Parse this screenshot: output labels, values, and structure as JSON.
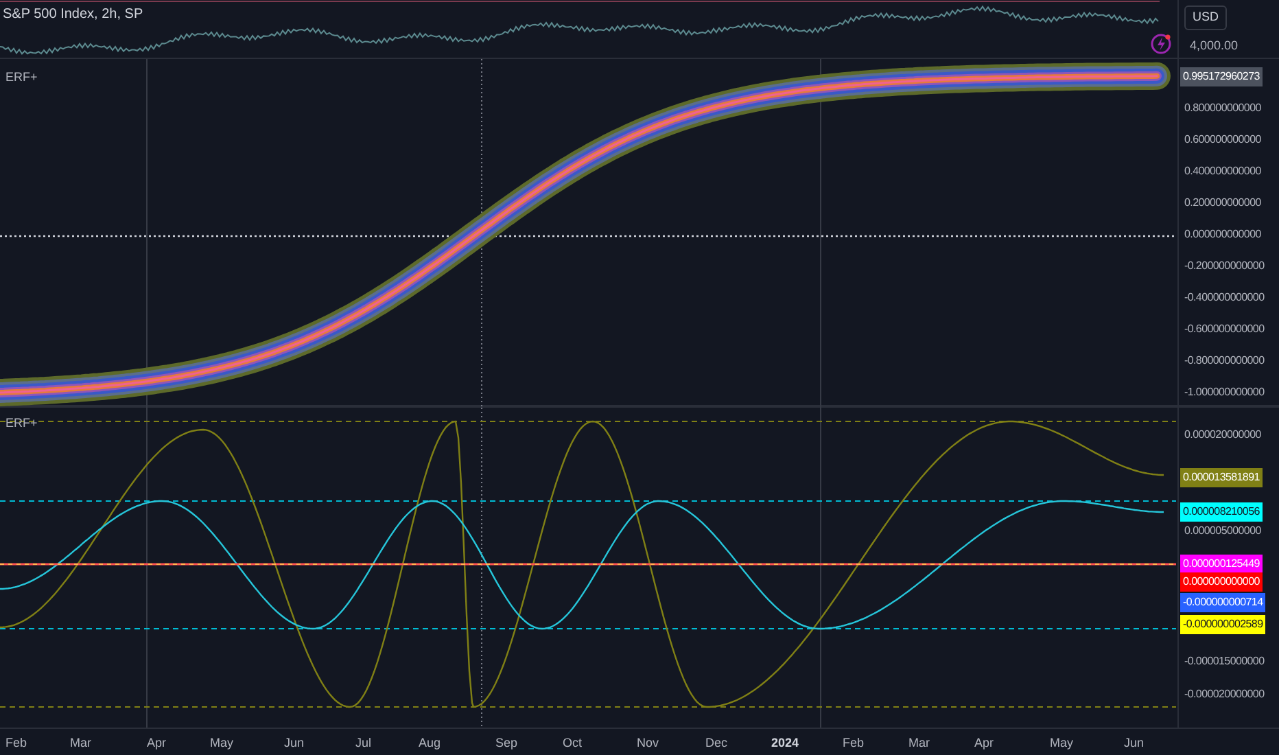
{
  "symbol_title": "S&P 500 Index, 2h, SP",
  "currency": "USD",
  "price_axis": [
    "4,000.00"
  ],
  "erf_pane": {
    "title": "ERF+",
    "last_value": "0.995172960273",
    "axis_labels": [
      "0.800000000000",
      "0.600000000000",
      "0.400000000000",
      "0.200000000000",
      "0.000000000000",
      "-0.200000000000",
      "-0.400000000000",
      "-0.600000000000",
      "-0.800000000000",
      "-1.000000000000"
    ]
  },
  "osc_pane": {
    "title": "ERF+",
    "axis_labels": [
      "0.000020000000",
      "0.000005000000",
      "-0.000015000000",
      "-0.000020000000"
    ],
    "value_tags": [
      {
        "text": "0.000013581891",
        "color": "#808015"
      },
      {
        "text": "0.000008210056",
        "color": "#00ffff"
      },
      {
        "text": "0.000000125449",
        "color": "#ff00ff"
      },
      {
        "text": "0.000000000000",
        "color": "#ff0000"
      },
      {
        "text": "-0.000000000714",
        "color": "#2962ff"
      },
      {
        "text": "-0.000000002589",
        "color": "#ffff00"
      }
    ]
  },
  "time_axis": [
    {
      "label": "Feb",
      "year": false
    },
    {
      "label": "Mar",
      "year": false
    },
    {
      "label": "Apr",
      "year": false
    },
    {
      "label": "May",
      "year": false
    },
    {
      "label": "Jun",
      "year": false
    },
    {
      "label": "Jul",
      "year": false
    },
    {
      "label": "Aug",
      "year": false
    },
    {
      "label": "Sep",
      "year": false
    },
    {
      "label": "Oct",
      "year": false
    },
    {
      "label": "Nov",
      "year": false
    },
    {
      "label": "Dec",
      "year": false
    },
    {
      "label": "2024",
      "year": true
    },
    {
      "label": "Feb",
      "year": false
    },
    {
      "label": "Mar",
      "year": false
    },
    {
      "label": "Apr",
      "year": false
    },
    {
      "label": "May",
      "year": false
    },
    {
      "label": "Jun",
      "year": false
    }
  ]
}
